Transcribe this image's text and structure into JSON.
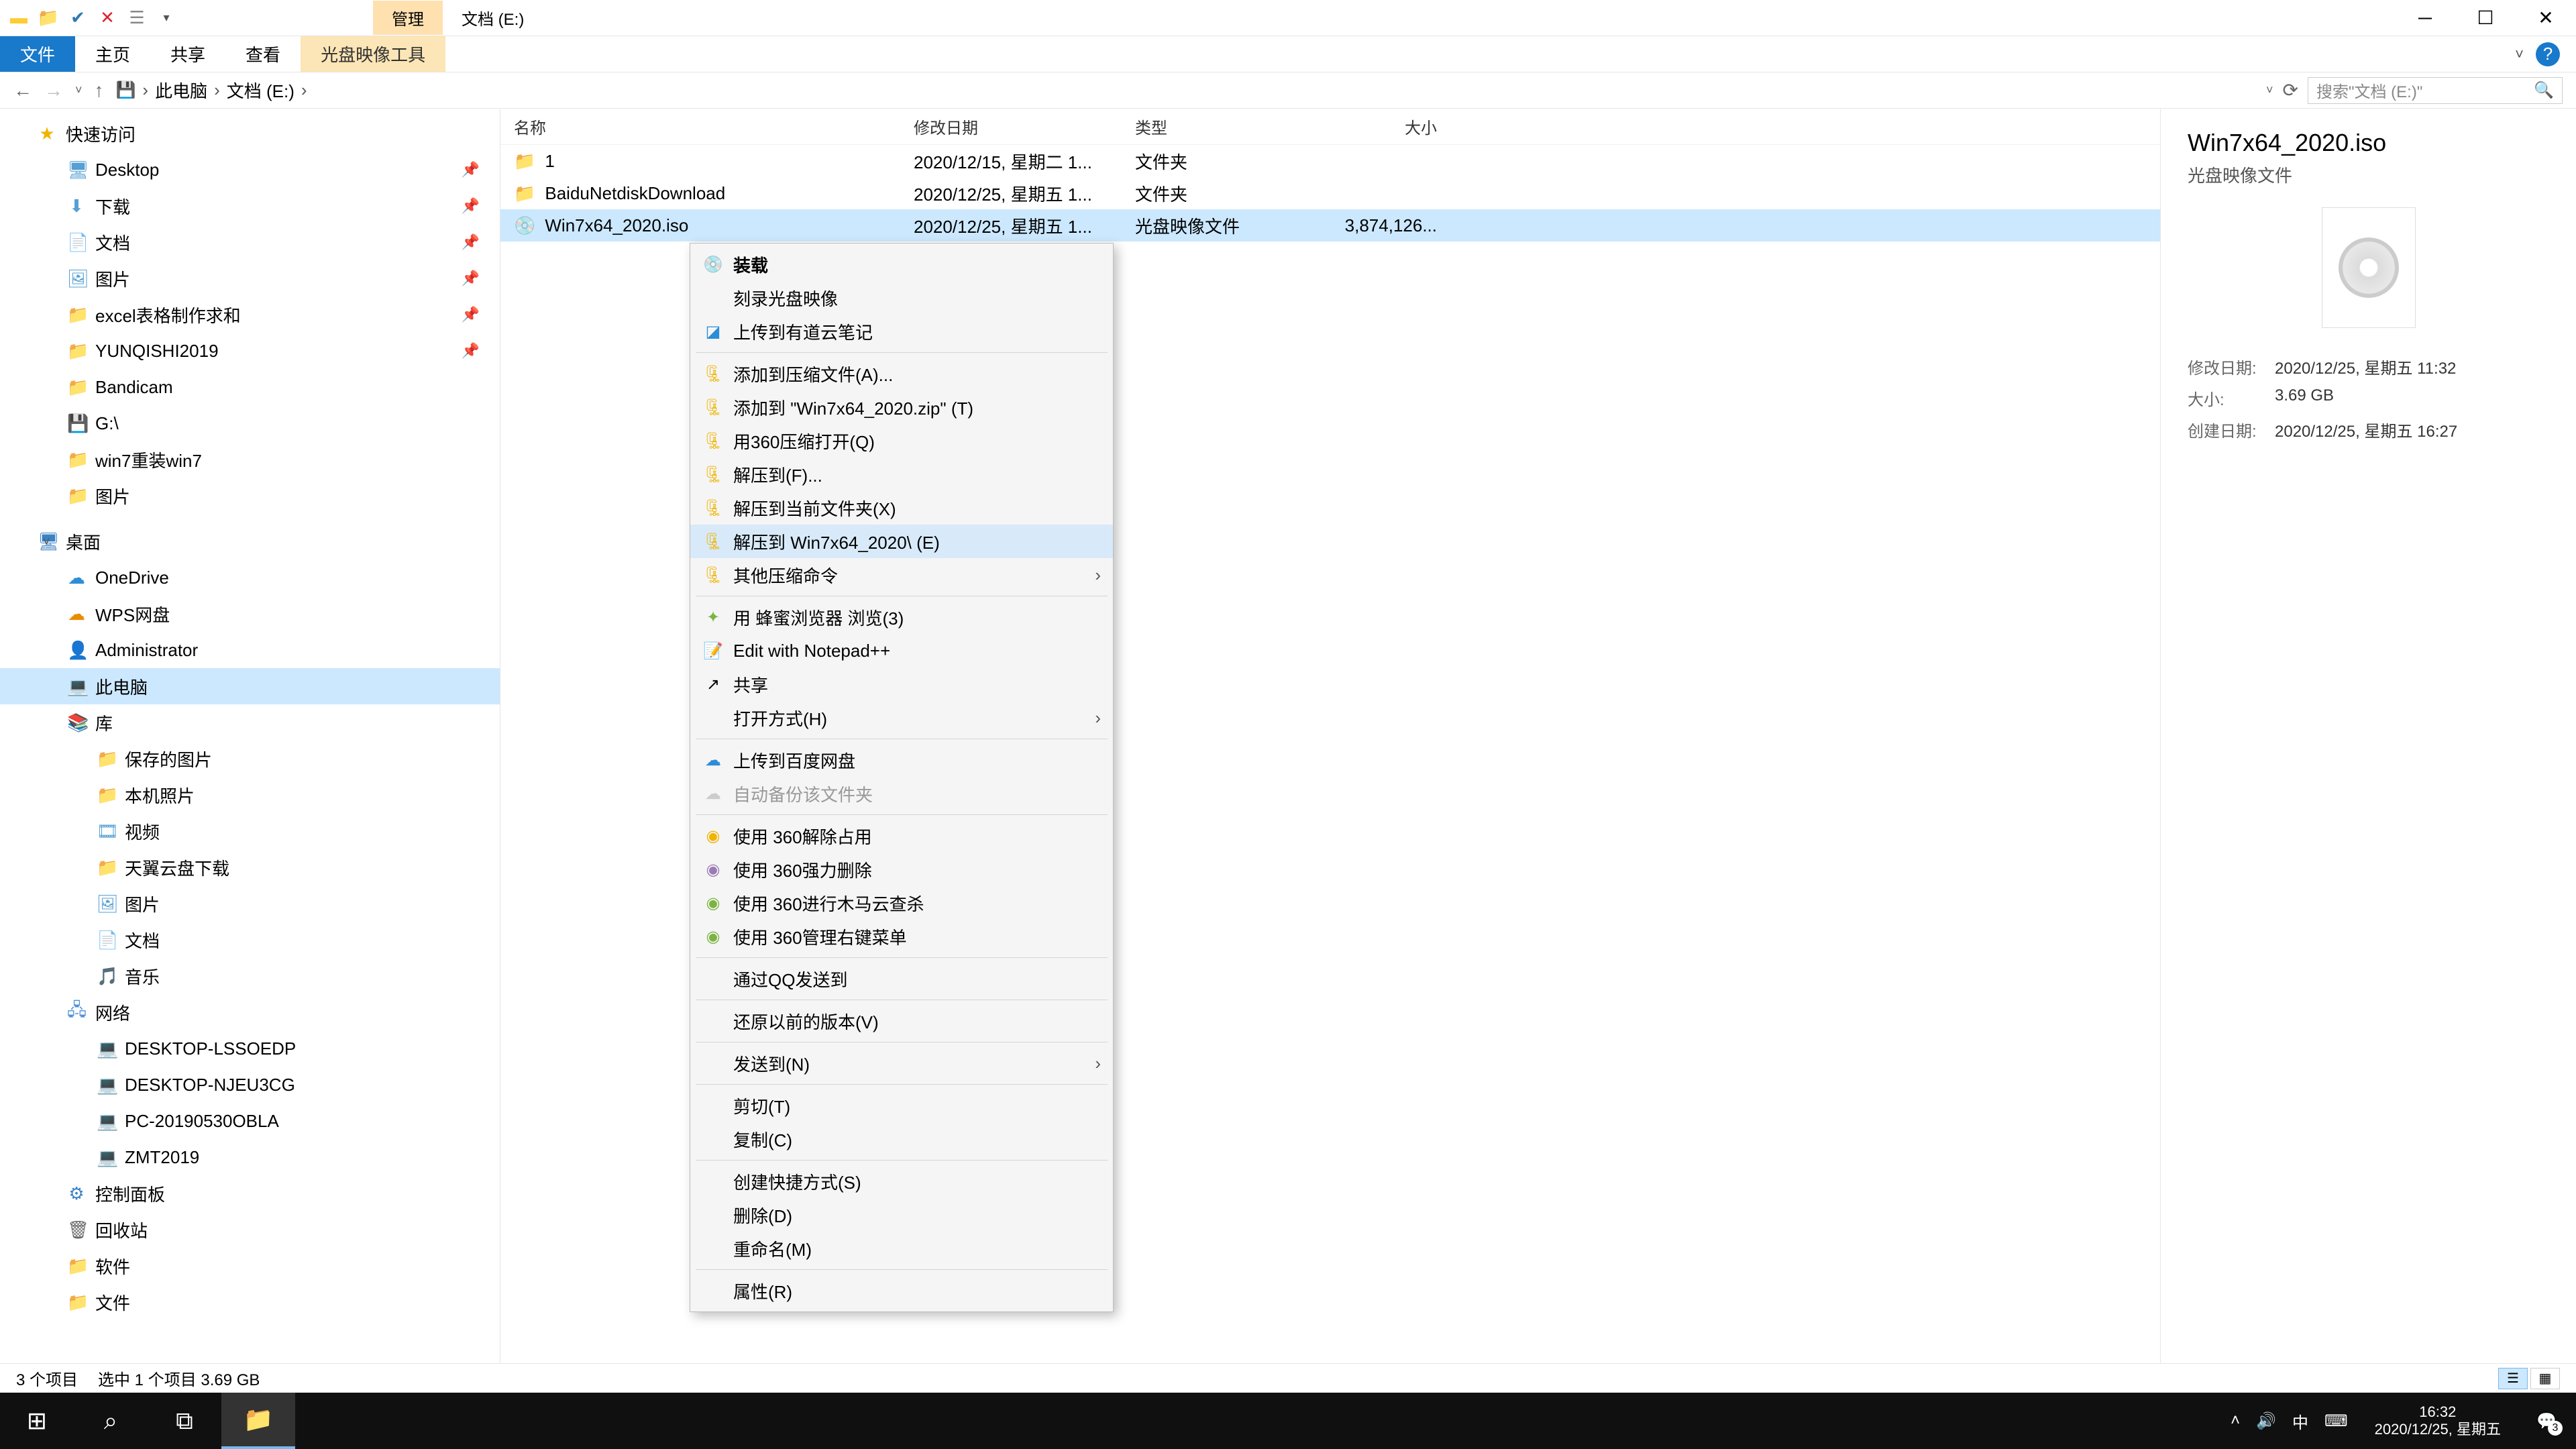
{
  "title_tabs": {
    "manage": "管理",
    "location": "文档 (E:)"
  },
  "ribbon": {
    "file": "文件",
    "home": "主页",
    "share": "共享",
    "view": "查看",
    "tool": "光盘映像工具"
  },
  "breadcrumb": {
    "this_pc": "此电脑",
    "drive": "文档 (E:)"
  },
  "search": {
    "placeholder": "搜索\"文档 (E:)\""
  },
  "nav": {
    "quick_access": "快速访问",
    "desktop": "Desktop",
    "downloads": "下载",
    "documents": "文档",
    "pictures_qa": "图片",
    "excel": "excel表格制作求和",
    "yunqishi": "YUNQISHI2019",
    "bandicam": "Bandicam",
    "gdrive": "G:\\",
    "win7reinstall": "win7重装win7",
    "pictures2": "图片",
    "desktop_section": "桌面",
    "onedrive": "OneDrive",
    "wps": "WPS网盘",
    "admin": "Administrator",
    "this_pc": "此电脑",
    "library": "库",
    "saved_pics": "保存的图片",
    "local_photos": "本机照片",
    "videos": "视频",
    "tianyi": "天翼云盘下载",
    "pictures_lib": "图片",
    "docs_lib": "文档",
    "music": "音乐",
    "network": "网络",
    "pc1": "DESKTOP-LSSOEDP",
    "pc2": "DESKTOP-NJEU3CG",
    "pc3": "PC-20190530OBLA",
    "pc4": "ZMT2019",
    "control_panel": "控制面板",
    "recycle": "回收站",
    "software": "软件",
    "files": "文件"
  },
  "columns": {
    "name": "名称",
    "date": "修改日期",
    "type": "类型",
    "size": "大小"
  },
  "rows": [
    {
      "name": "1",
      "date": "2020/12/15, 星期二 1...",
      "type": "文件夹",
      "size": ""
    },
    {
      "name": "BaiduNetdiskDownload",
      "date": "2020/12/25, 星期五 1...",
      "type": "文件夹",
      "size": ""
    },
    {
      "name": "Win7x64_2020.iso",
      "date": "2020/12/25, 星期五 1...",
      "type": "光盘映像文件",
      "size": "3,874,126..."
    }
  ],
  "context_menu": {
    "mount": "装载",
    "burn": "刻录光盘映像",
    "youdao": "上传到有道云笔记",
    "add_archive": "添加到压缩文件(A)...",
    "add_zip": "添加到 \"Win7x64_2020.zip\" (T)",
    "open_360": "用360压缩打开(Q)",
    "extract_to": "解压到(F)...",
    "extract_here": "解压到当前文件夹(X)",
    "extract_named": "解压到 Win7x64_2020\\ (E)",
    "other_compress": "其他压缩命令",
    "bee_browser": "用 蜂蜜浏览器 浏览(3)",
    "notepad": "Edit with Notepad++",
    "share": "共享",
    "open_with": "打开方式(H)",
    "baidu_upload": "上传到百度网盘",
    "auto_backup": "自动备份该文件夹",
    "unlock_360": "使用 360解除占用",
    "force_del_360": "使用 360强力删除",
    "trojan_360": "使用 360进行木马云查杀",
    "rclick_360": "使用 360管理右键菜单",
    "qq_send": "通过QQ发送到",
    "restore_prev": "还原以前的版本(V)",
    "send_to": "发送到(N)",
    "cut": "剪切(T)",
    "copy": "复制(C)",
    "shortcut": "创建快捷方式(S)",
    "delete": "删除(D)",
    "rename": "重命名(M)",
    "properties": "属性(R)"
  },
  "details": {
    "title": "Win7x64_2020.iso",
    "subtitle": "光盘映像文件",
    "modified_k": "修改日期:",
    "modified_v": "2020/12/25, 星期五 11:32",
    "size_k": "大小:",
    "size_v": "3.69 GB",
    "created_k": "创建日期:",
    "created_v": "2020/12/25, 星期五 16:27"
  },
  "status": {
    "count": "3 个项目",
    "selection": "选中 1 个项目  3.69 GB"
  },
  "taskbar": {
    "ime": "中",
    "time": "16:32",
    "date": "2020/12/25, 星期五",
    "notif_count": "3"
  }
}
